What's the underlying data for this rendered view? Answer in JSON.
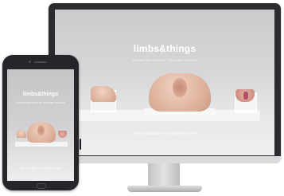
{
  "monitor": {
    "logo": "limbs&things",
    "subtitle": "CATHETERIZATION TRAINER RANGE",
    "caption": "Also available in a dark skin tone"
  },
  "phone": {
    "logo": "limbs&things",
    "subtitle": "CATHETERIZATION TRAINER RANGE",
    "caption": "Also available in a dark skin tone"
  },
  "colors": {
    "device_frame": "#2b2c2f",
    "screen_background": "#d3d4d5",
    "product_skin": "#e2b9a5",
    "product_accent": "#b14f66"
  }
}
